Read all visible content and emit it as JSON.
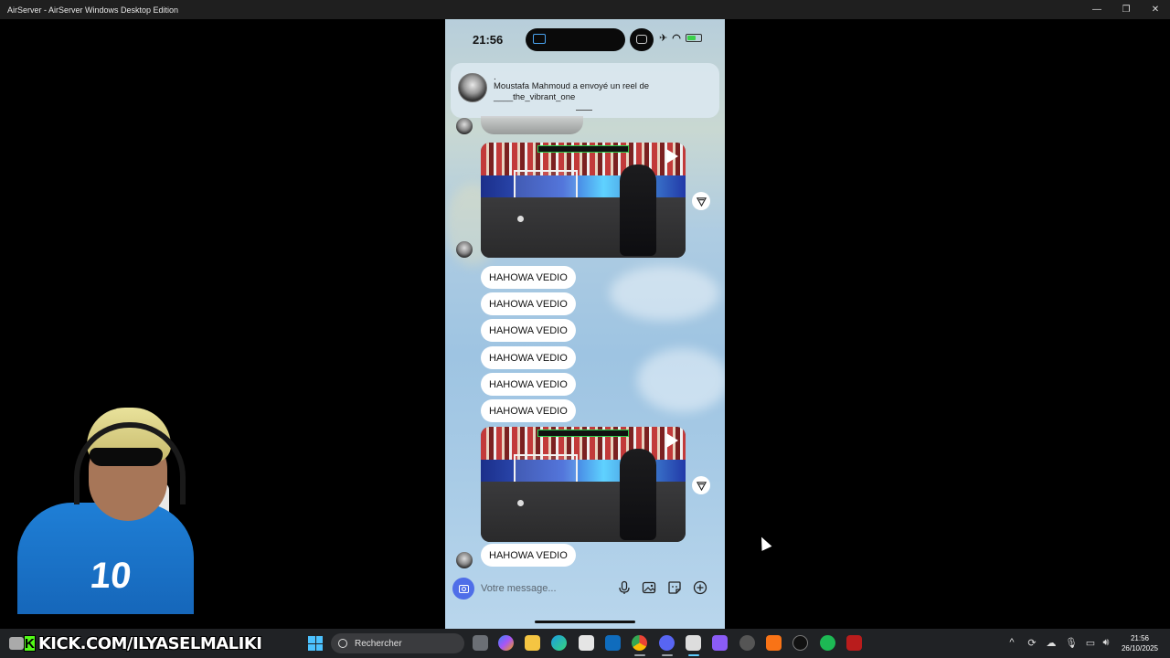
{
  "window": {
    "title": "AirServer - AirServer Windows Desktop Edition",
    "minimize_glyph": "—",
    "restore_glyph": "❐",
    "close_glyph": "✕"
  },
  "phone": {
    "time": "21:56",
    "airplane_glyph": "✈",
    "wifi_glyph": "◠"
  },
  "notification": {
    "dot": ".",
    "text": "Moustafa Mahmoud a envoyé un reel de ____the_vibrant_one"
  },
  "messages": [
    {
      "text": "HAHOWA VEDIO"
    },
    {
      "text": "HAHOWA VEDIO"
    },
    {
      "text": "HAHOWA VEDIO"
    },
    {
      "text": "HAHOWA VEDIO"
    },
    {
      "text": "HAHOWA VEDIO"
    },
    {
      "text": "HAHOWA VEDIO"
    },
    {
      "text": "HAHOWA VEDIO"
    }
  ],
  "composer": {
    "placeholder": "Votre message..."
  },
  "taskbar": {
    "kick_letter": "K",
    "kick_text": "KICK.COM/ILYASELMALIKI",
    "search_label": "Rechercher",
    "time": "21:56",
    "date": "26/10/2025",
    "tray_up_glyph": "^"
  },
  "webcam": {
    "jersey_number": "10"
  },
  "icons": {
    "video_play": "play-icon",
    "share": "send-icon",
    "camera": "camera-icon",
    "mic": "microphone-icon",
    "gallery": "image-icon",
    "sticker": "sticker-icon",
    "add": "plus-icon"
  },
  "colors": {
    "accent": "#4f6ee8",
    "kick_green": "#53fc18",
    "battery_green": "#3bd04a"
  }
}
